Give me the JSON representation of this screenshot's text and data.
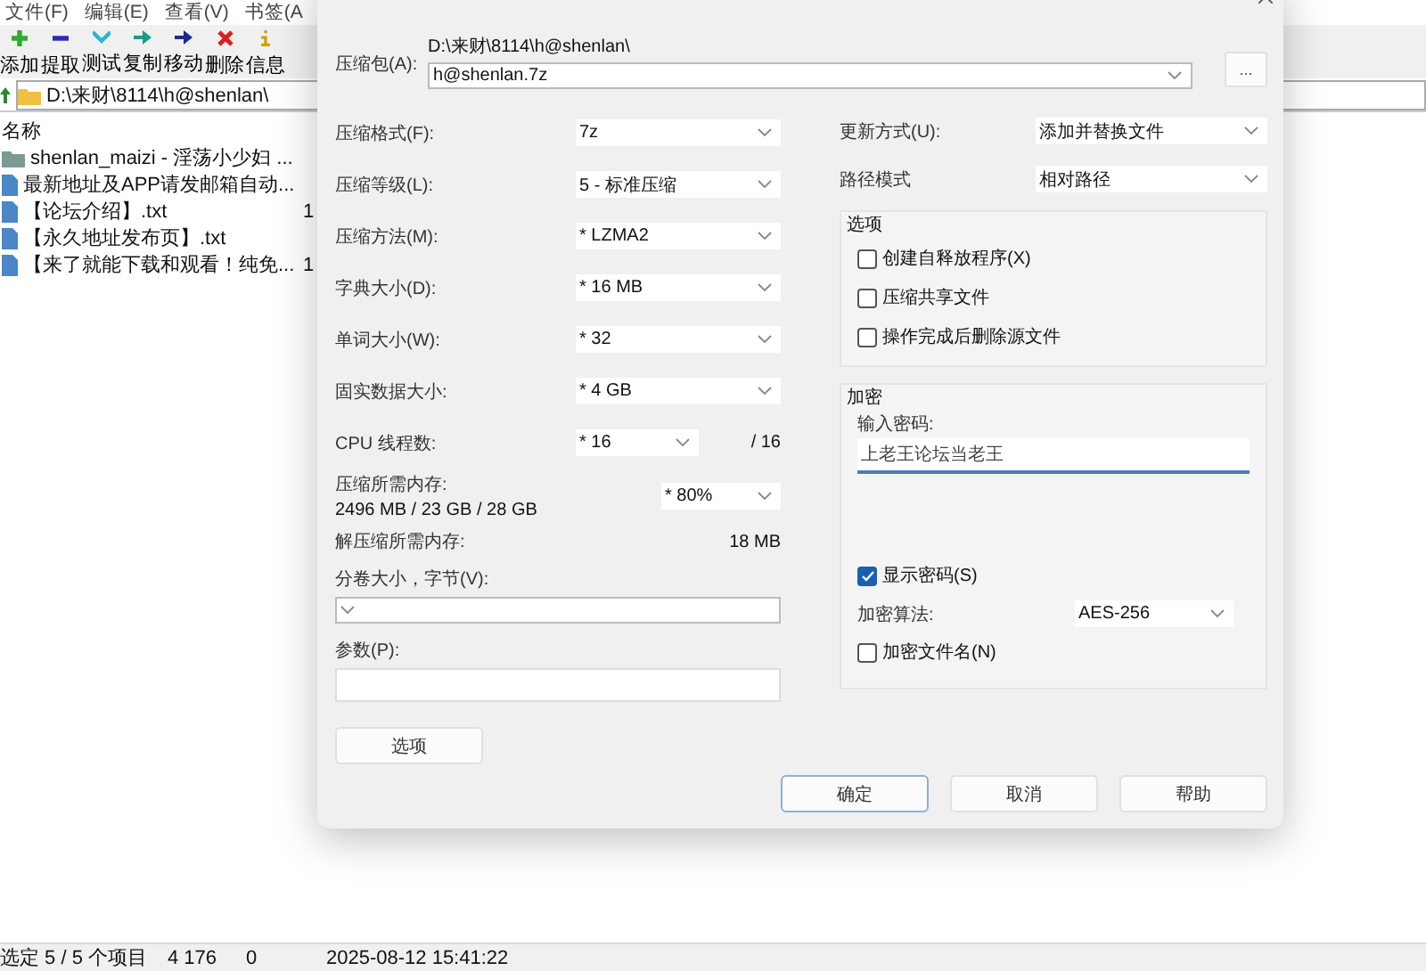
{
  "app": {
    "menu": [
      "文件(F)",
      "编辑(E)",
      "查看(V)",
      "书签(A"
    ],
    "toolbar": [
      {
        "label": "添加"
      },
      {
        "label": "提取"
      },
      {
        "label": "测试"
      },
      {
        "label": "复制"
      },
      {
        "label": "移动"
      },
      {
        "label": "删除"
      },
      {
        "label": "信息"
      }
    ],
    "address": "D:\\来财\\8114\\h@shenlan\\",
    "columns": [
      "名称"
    ],
    "files": [
      {
        "name": "shenlan_maizi - 淫荡小少妇 ...",
        "kind": "folder"
      },
      {
        "name": "最新地址及APP请发邮箱自动...",
        "kind": "file"
      },
      {
        "name": "【论坛介绍】.txt",
        "kind": "file",
        "size": "1"
      },
      {
        "name": "【永久地址发布页】.txt",
        "kind": "file"
      },
      {
        "name": "【来了就能下载和观看！纯免...",
        "kind": "file",
        "size": "1"
      }
    ],
    "status_bar": [
      "选定 5 / 5 个项目",
      "4 176",
      "0",
      "2025-08-12 15:41:22"
    ]
  },
  "dialog": {
    "archive_label": "压缩包(A):",
    "archive_path": "D:\\来财\\8114\\h@shenlan\\",
    "archive_name": "h@shenlan.7z",
    "browse_button": "...",
    "left_settings": [
      {
        "label": "压缩格式(F):",
        "value": "7z"
      },
      {
        "label": "压缩等级(L):",
        "value": "5 - 标准压缩"
      },
      {
        "label": "压缩方法(M):",
        "value": "* LZMA2"
      },
      {
        "label": "字典大小(D):",
        "value": "* 16 MB"
      },
      {
        "label": "单词大小(W):",
        "value": "* 32"
      },
      {
        "label": "固实数据大小:",
        "value": "* 4 GB"
      }
    ],
    "cpu": {
      "label": "CPU 线程数:",
      "value": "* 16",
      "max": "/ 16"
    },
    "memory": {
      "label": "压缩所需内存:",
      "usage": "2496 MB / 23 GB / 28 GB",
      "value": "* 80%"
    },
    "decompress_memory": {
      "label": "解压缩所需内存:",
      "value": "18 MB"
    },
    "split": {
      "label": "分卷大小，字节(V):"
    },
    "params": {
      "label": "参数(P):"
    },
    "options_button": "选项",
    "right_settings": [
      {
        "label": "更新方式(U):",
        "value": "添加并替换文件"
      },
      {
        "label": "路径模式",
        "value": "相对路径"
      }
    ],
    "options_group": {
      "title": "选项",
      "checkboxes": [
        {
          "label": "创建自释放程序(X)",
          "checked": false
        },
        {
          "label": "压缩共享文件",
          "checked": false
        },
        {
          "label": "操作完成后删除源文件",
          "checked": false
        }
      ]
    },
    "encryption": {
      "title": "加密",
      "password_label": "输入密码:",
      "password": "上老王论坛当老王",
      "show_password": {
        "label": "显示密码(S)",
        "checked": true
      },
      "method_label": "加密算法:",
      "method": "AES-256",
      "encrypt_names": {
        "label": "加密文件名(N)",
        "checked": false
      }
    },
    "buttons": [
      {
        "label": "确定",
        "default": true
      },
      {
        "label": "取消",
        "default": false
      },
      {
        "label": "帮助",
        "default": false
      }
    ]
  }
}
